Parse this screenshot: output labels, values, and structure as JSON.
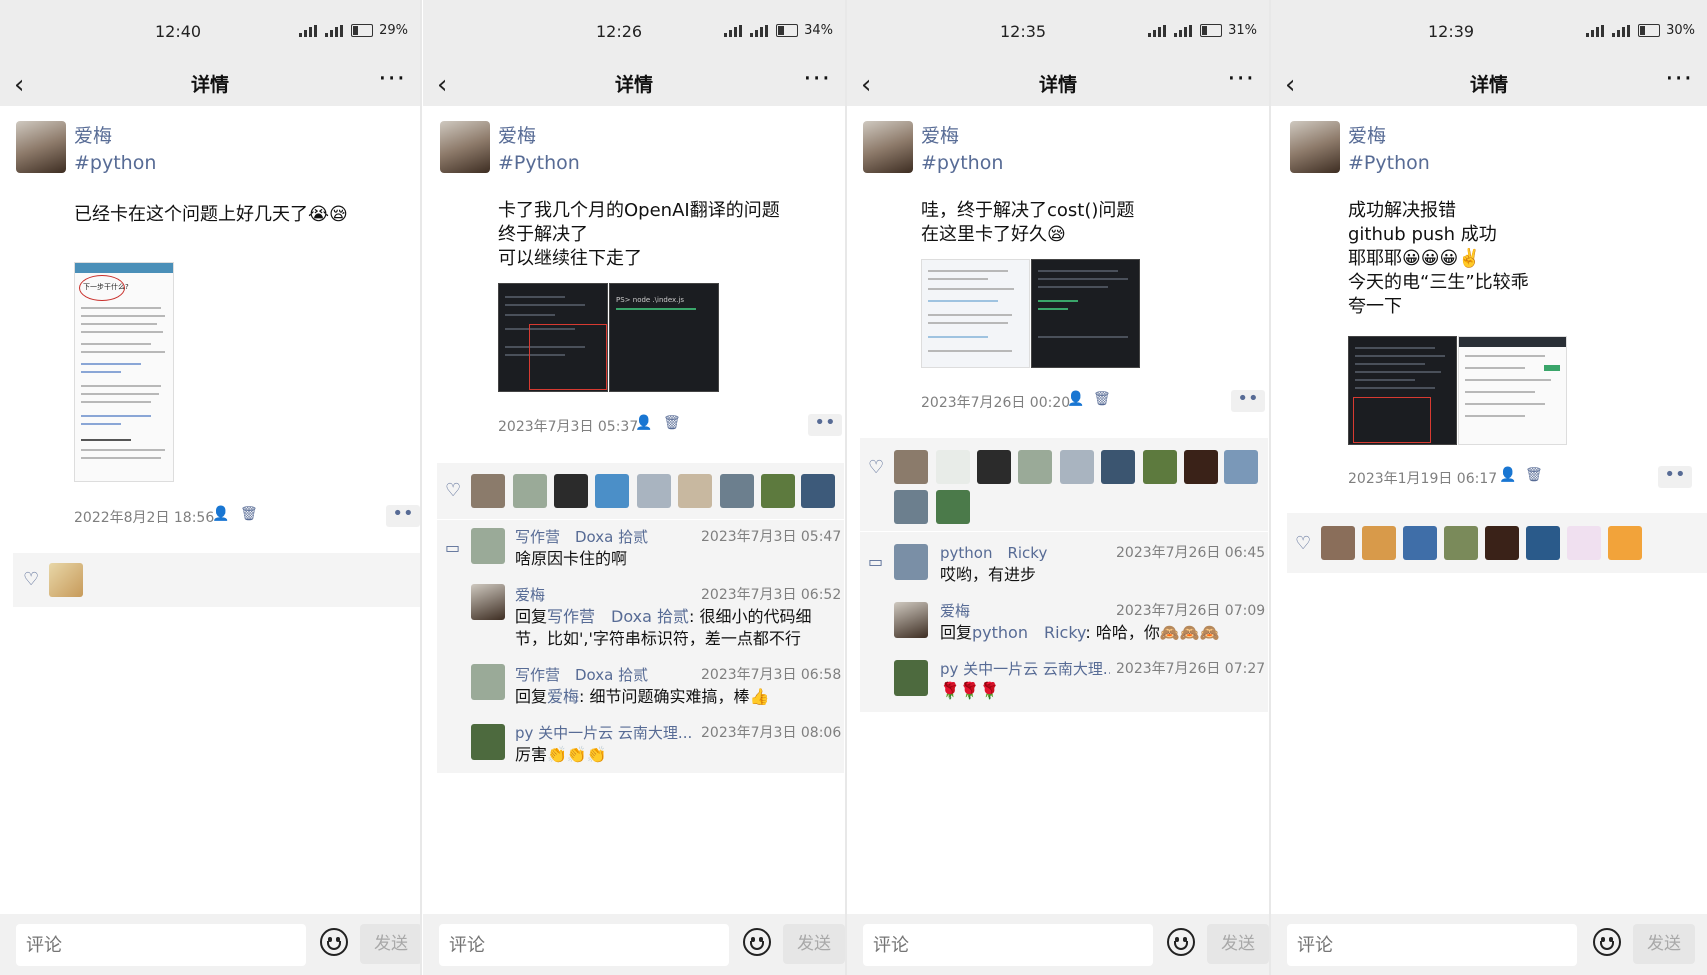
{
  "common": {
    "title": "详情",
    "back": "‹",
    "more": "···",
    "comment_placeholder": "评论",
    "send_label": "发送",
    "signal_label_1": "5G",
    "signal_label_2": "4G"
  },
  "panels": [
    {
      "time": "12:40",
      "battery": "29%",
      "battery_level": 0.29,
      "username": "爱梅",
      "tag": "#python",
      "post_text": "已经卡在这个问题上好几天了😭😪",
      "image_caption": "下一步干什么?",
      "date": "2022年8月2日 18:56",
      "likes": [
        "cat"
      ],
      "comments": []
    },
    {
      "time": "12:26",
      "battery": "34%",
      "battery_level": 0.34,
      "username": "爱梅",
      "tag": "#Python",
      "post_text": "卡了我几个月的OpenAI翻译的问题\n终于解决了\n可以继续往下走了",
      "image_caption": "PS> node .\\index.js",
      "date": "2023年7月3日 05:37",
      "likes": [
        "a1",
        "a2",
        "a3",
        "a4",
        "a5",
        "a6",
        "a7",
        "a8",
        "a9"
      ],
      "comments": [
        {
          "name": "写作营　Doxa 拾贰",
          "time": "2023年7月3日 05:47",
          "text": "啥原因卡住的啊",
          "reply_to": ""
        },
        {
          "name": "爱梅",
          "time": "2023年7月3日 06:52",
          "text": ": 很细小的代码细节，比如','字符串标识符，差一点都不行",
          "reply_to": "写作营　Doxa 拾贰"
        },
        {
          "name": "写作营　Doxa 拾贰",
          "time": "2023年7月3日 06:58",
          "text": ": 细节问题确实难搞，棒👍",
          "reply_to": "爱梅"
        },
        {
          "name": "py 关中一片云 云南大理...",
          "time": "2023年7月3日 08:06",
          "text": "厉害👏👏👏",
          "reply_to": ""
        }
      ]
    },
    {
      "time": "12:35",
      "battery": "31%",
      "battery_level": 0.31,
      "username": "爱梅",
      "tag": "#python",
      "post_text": "哇，终于解决了cost()问题\n在这里卡了好久😪",
      "date": "2023年7月26日 00:20",
      "likes": [
        "b1",
        "b2",
        "b3",
        "b4",
        "b5",
        "b6",
        "b7",
        "b8",
        "b9",
        "b10",
        "b11"
      ],
      "comments": [
        {
          "name": "python　Ricky",
          "time": "2023年7月26日 06:45",
          "text": "哎哟，有进步",
          "reply_to": ""
        },
        {
          "name": "爱梅",
          "time": "2023年7月26日 07:09",
          "text": ": 哈哈，你🙈🙈🙈",
          "reply_to": "python　Ricky"
        },
        {
          "name": "py 关中一片云 云南大理...",
          "time": "2023年7月26日 07:27",
          "text": "🌹🌹🌹",
          "reply_to": ""
        }
      ]
    },
    {
      "time": "12:39",
      "battery": "30%",
      "battery_level": 0.3,
      "username": "爱梅",
      "tag": "#Python",
      "post_text": "成功解决报错\ngithub push 成功\n耶耶耶😀😀😀✌️\n今天的电“三生”比较乖\n夸一下",
      "date": "2023年1月19日 06:17",
      "likes": [
        "c1",
        "c2",
        "c3",
        "c4",
        "c5",
        "c6",
        "c7",
        "c8"
      ],
      "comments": []
    }
  ],
  "reply_prefix": "回复",
  "colors": {
    "link": "#576b95",
    "bar": "#ededed",
    "meta": "#7f7f7f"
  }
}
